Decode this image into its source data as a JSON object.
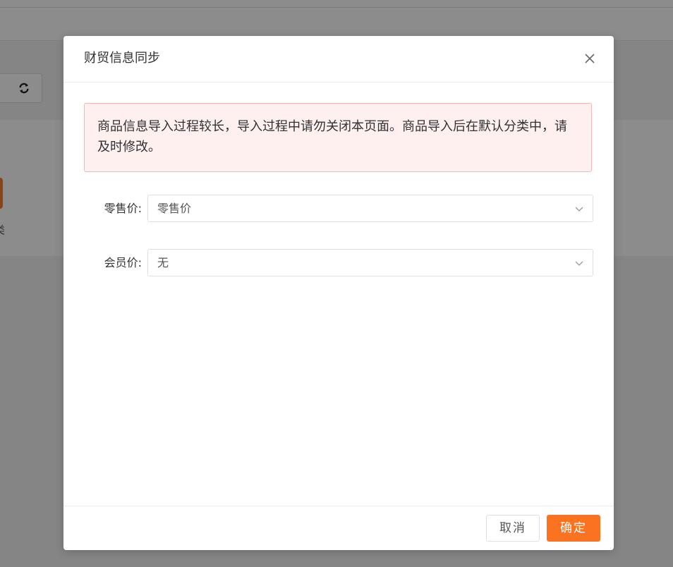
{
  "background": {
    "side_label": "类"
  },
  "dialog": {
    "title": "财贸信息同步",
    "close_icon": "close-icon",
    "notice": "商品信息导入过程较长，导入过程中请勿关闭本页面。商品导入后在默认分类中，请及时修改。",
    "fields": [
      {
        "label": "零售价:",
        "value": "零售价"
      },
      {
        "label": "会员价:",
        "value": "无"
      }
    ],
    "cancel_label": "取消",
    "confirm_label": "确定"
  },
  "colors": {
    "accent": "#fb7320",
    "alert_bg": "#fff0f0",
    "alert_border": "#f7b6b6",
    "overlay": "rgba(0,0,0,0.45)"
  }
}
